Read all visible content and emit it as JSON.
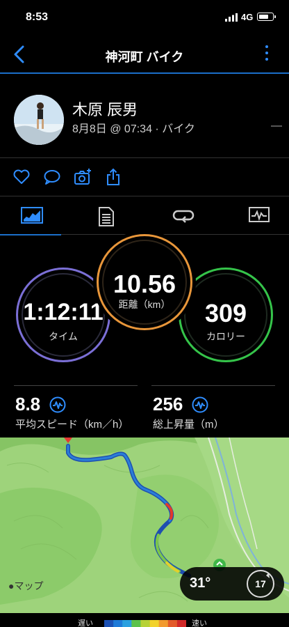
{
  "status": {
    "time": "8:53",
    "network": "4G"
  },
  "nav": {
    "title": "神河町 バイク"
  },
  "profile": {
    "name": "木原 辰男",
    "meta": "8月8日 @ 07:34 · バイク"
  },
  "rings": {
    "distance": {
      "value": "10.56",
      "label": "距離（km）",
      "color": "#e8963a"
    },
    "time": {
      "value": "1:12:11",
      "label": "タイム",
      "color": "#7b6fd6"
    },
    "calories": {
      "value": "309",
      "label": "カロリー",
      "color": "#35c44a"
    }
  },
  "stats": {
    "speed": {
      "value": "8.8",
      "label": "平均スピード（km／h）"
    },
    "ascent": {
      "value": "256",
      "label": "総上昇量（m）"
    }
  },
  "map": {
    "brand": "マップ",
    "temperature": "31°",
    "wind": "17"
  },
  "legend": {
    "slow": "遅い",
    "fast": "速い",
    "colors": [
      "#1b50b3",
      "#1e7ad8",
      "#2aa0e0",
      "#5cc24b",
      "#b6d236",
      "#f2d22c",
      "#f29a2e",
      "#e35a2a",
      "#d02828"
    ]
  },
  "colors": {
    "accent": "#2f8dff",
    "divider": "#1b6fc9"
  }
}
